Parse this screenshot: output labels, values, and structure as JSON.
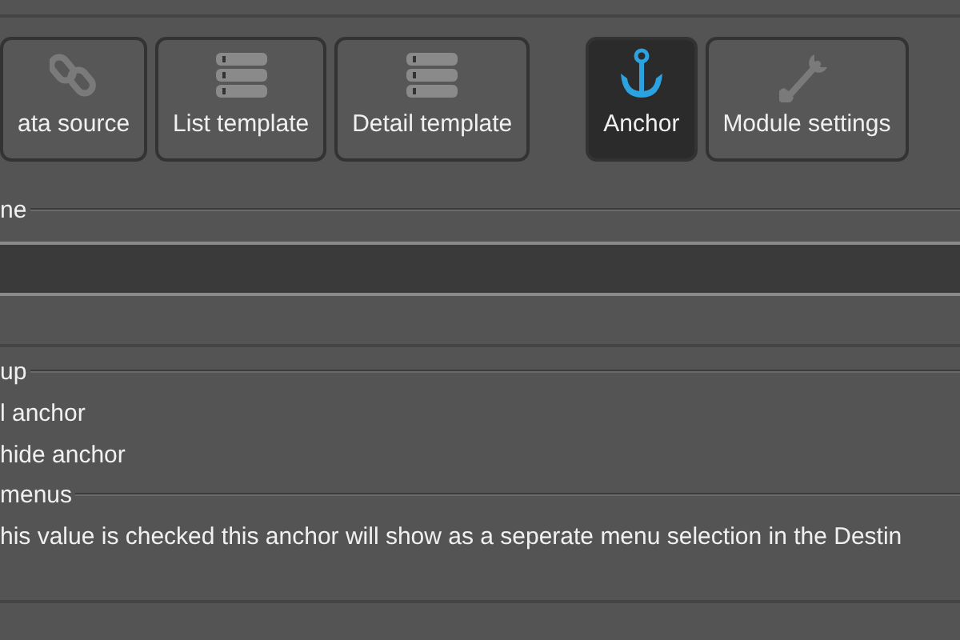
{
  "toolbar": [
    {
      "label": "ata source",
      "kind": "link",
      "selected": false
    },
    {
      "label": "List template",
      "kind": "list",
      "selected": false
    },
    {
      "label": "Detail template",
      "kind": "list",
      "selected": false
    },
    {
      "label": "Anchor",
      "kind": "anchor",
      "selected": true
    },
    {
      "label": "Module settings",
      "kind": "wrench",
      "selected": false
    }
  ],
  "sections": [
    {
      "legend": "ne",
      "items": [
        {
          "kind": "field",
          "value": ""
        }
      ]
    },
    {
      "legend": "up",
      "items": [
        {
          "kind": "text",
          "text": "l anchor"
        },
        {
          "kind": "text",
          "text": "hide anchor"
        }
      ]
    },
    {
      "legend": "menus",
      "items": [
        {
          "kind": "text",
          "text": "his value is checked this anchor will show as a seperate menu selection in the Destin"
        }
      ]
    }
  ]
}
